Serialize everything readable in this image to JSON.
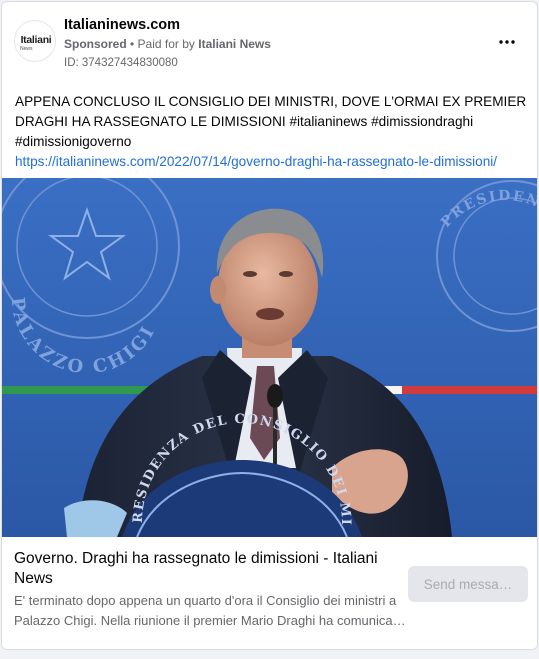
{
  "post": {
    "page_name": "Italianinews.com",
    "sponsored_label": "Sponsored",
    "paid_prefix": " • Paid for by ",
    "paid_by": "Italiani News",
    "ad_id": "ID: 374327434830080",
    "avatar_logo_main": "Italiani",
    "avatar_logo_sub": "News",
    "more_icon": "more-horizontal-icon",
    "text_line1": "APPENA CONCLUSO IL CONSIGLIO DEI MINISTRI, DOVE L'ORMAI EX PREMIER DRAGHI HA RASSEGNATO LE DIMISSIONI ",
    "hashtags": [
      "#italianinews",
      "#dimissiondraghi",
      "#dimissionigoverno"
    ],
    "link": "https://italianinews.com/2022/07/14/governo-draghi-ha-rassegnato-le-dimissioni/"
  },
  "preview": {
    "title": "Governo. Draghi ha rassegnato le dimissioni - Italiani News",
    "description": "E' terminato dopo appena un quarto d'ora il Consiglio dei ministri a Palazzo Chigi. Nella riunione il premier Mario Draghi ha comunicato le dimissioni",
    "send_button_label": "Send messa…"
  },
  "image": {
    "seal_text_left": "PALAZZO CHIGI",
    "seal_text_right": "PRESIDENZA DEL CONSIGLIO DEI MINISTRI",
    "podium_text": "RESIDENZA DEL CONSIGLIO DEI MINI"
  },
  "colors": {
    "link": "#216fdb",
    "background_blue": "#2a5fb8",
    "button_bg": "#e4e6eb",
    "muted_text": "#65676b"
  }
}
